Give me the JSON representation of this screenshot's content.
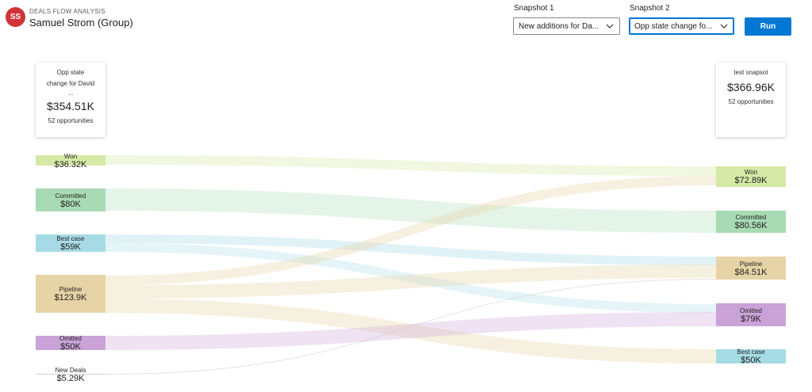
{
  "header": {
    "avatar_initials": "SS",
    "app_title": "DEALS FLOW ANALYSIS",
    "owner_name": "Samuel Strom (Group)"
  },
  "controls": {
    "snapshot1_label": "Snapshot 1",
    "snapshot1_value": "New additions for Da...",
    "snapshot2_label": "Snapshot 2",
    "snapshot2_value": "Opp state change fo...",
    "run_label": "Run"
  },
  "left_card": {
    "title_line1": "Opp state",
    "title_line2": "change for David",
    "title_line3": "...",
    "amount": "$354.51K",
    "count": "52 opportunities"
  },
  "right_card": {
    "title": "test snapsot",
    "amount": "$366.96K",
    "count": "52 opportunities"
  },
  "left_nodes": [
    {
      "label": "Won",
      "value": "$36.32K",
      "color": "#d6e9a6"
    },
    {
      "label": "Committed",
      "value": "$80K",
      "color": "#a8dbb4"
    },
    {
      "label": "Best case",
      "value": "$59K",
      "color": "#a6dbe5"
    },
    {
      "label": "Pipeline",
      "value": "$123.9K",
      "color": "#e6d4a6"
    },
    {
      "label": "Omitted",
      "value": "$50K",
      "color": "#c9a3d8"
    },
    {
      "label": "New Deals",
      "value": "$5.29K",
      "color": "#d0d0d0"
    }
  ],
  "right_nodes": [
    {
      "label": "Won",
      "value": "$72.89K",
      "color": "#d6e9a6"
    },
    {
      "label": "Committed",
      "value": "$80.56K",
      "color": "#a8dbb4"
    },
    {
      "label": "Pipeline",
      "value": "$84.51K",
      "color": "#e6d4a6"
    },
    {
      "label": "Omitted",
      "value": "$79K",
      "color": "#c9a3d8"
    },
    {
      "label": "Best case",
      "value": "$50K",
      "color": "#a6dbe5"
    }
  ],
  "icons": {
    "dropdown": "chevron-down-icon"
  }
}
